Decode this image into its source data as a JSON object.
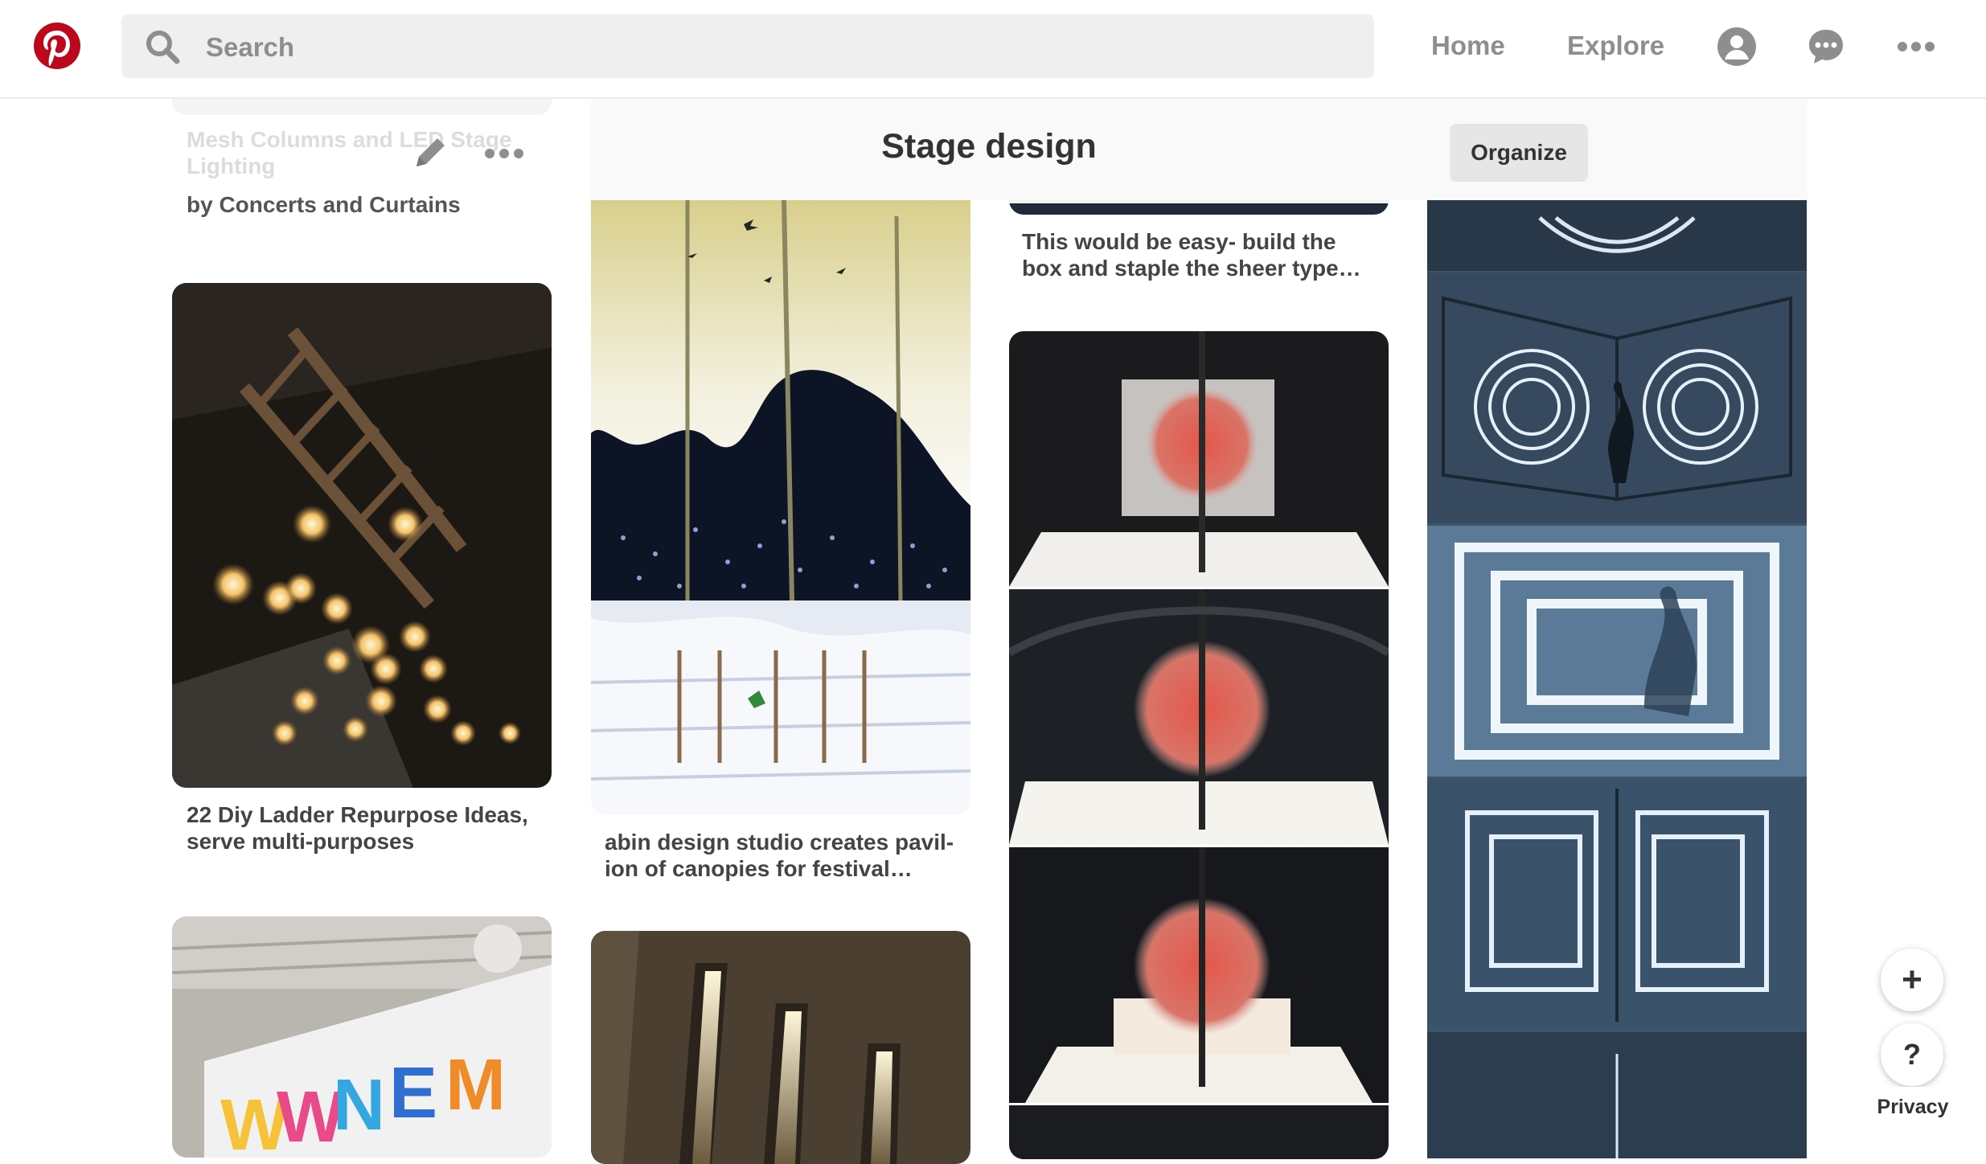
{
  "topbar": {
    "search_placeholder": "Search",
    "nav": {
      "home": "Home",
      "explore": "Explore"
    },
    "icons": [
      "pinterest-logo",
      "search-icon",
      "profile-icon",
      "messages-icon",
      "more-icon"
    ],
    "brand_color": "#bd081c"
  },
  "board": {
    "title": "Stage design",
    "organize_label": "Organize"
  },
  "pins": [
    {
      "title": "Mesh Columns and LED Stage Lighting",
      "byline": "by Concerts and Curtains"
    },
    {
      "title": "22 Diy Ladder Repurpose Ideas, serve multi-purposes"
    },
    {
      "title": "abin design studio creates pavil-ion of canopies for festival…"
    },
    {
      "title": "This would be easy- build the box and staple the sheer type…"
    }
  ],
  "floating": {
    "add_label": "+",
    "help_label": "?",
    "privacy_label": "Privacy"
  }
}
